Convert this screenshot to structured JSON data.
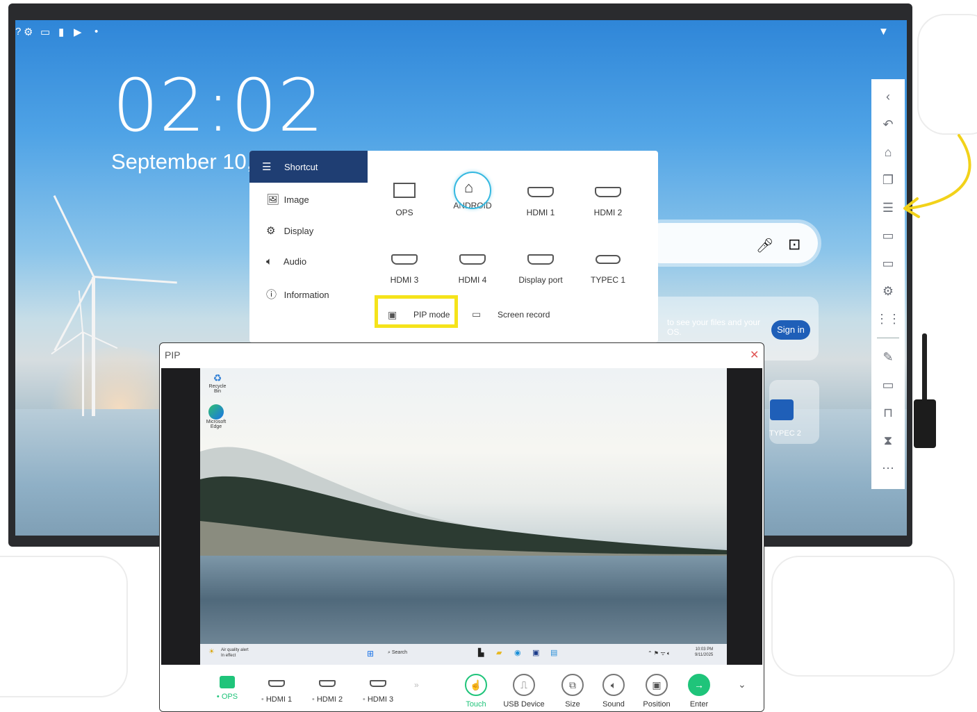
{
  "status_bar": {
    "icons": [
      "question-icon",
      "settings-gear-icon",
      "cast-icon",
      "usb-icon",
      "youtube-icon",
      "dot-icon"
    ],
    "wifi_icon": "wifi-icon"
  },
  "home": {
    "clock": "02:02",
    "date": "September 10,"
  },
  "shortcut_menu": {
    "tabs": [
      {
        "label": "Shortcut",
        "icon": "sliders-icon"
      },
      {
        "label": "Image",
        "icon": "image-icon"
      },
      {
        "label": "Display",
        "icon": "display-settings-icon"
      },
      {
        "label": "Audio",
        "icon": "speaker-icon"
      },
      {
        "label": "Information",
        "icon": "info-icon"
      }
    ],
    "sources": [
      "OPS",
      "ANDROID",
      "HDMI 1",
      "HDMI 2",
      "HDMI 3",
      "HDMI 4",
      "Display port",
      "TYPEC 1"
    ],
    "actions": {
      "pip": "PIP mode",
      "screen_record": "Screen record"
    }
  },
  "launcher": {
    "signin_hint": "to see your files and your OS.",
    "signin_button": "Sign in",
    "typec2_label": "TYPEC 2"
  },
  "sidebar": {
    "icons": [
      "collapse-chevron-icon",
      "back-icon",
      "home-icon",
      "windows-icon",
      "menu-icon",
      "cast-icon",
      "screen-icon",
      "settings-icon",
      "apps-icon",
      "pen-icon",
      "record-icon",
      "lock-icon",
      "timer-icon",
      "more-icon"
    ]
  },
  "pip": {
    "title": "PIP",
    "desktop": {
      "icons": [
        {
          "label": "Recycle Bin"
        },
        {
          "label": "Microsoft Edge"
        }
      ],
      "weather": "Air quality alert\nIn effect",
      "search": "Search",
      "time": "10:03 PM",
      "date": "9/11/2025"
    },
    "sources": [
      {
        "label": "OPS",
        "active": true
      },
      {
        "label": "HDMI 1",
        "active": false
      },
      {
        "label": "HDMI 2",
        "active": false
      },
      {
        "label": "HDMI 3",
        "active": false
      }
    ],
    "controls": [
      "Touch",
      "USB Device",
      "Size",
      "Sound",
      "Position",
      "Enter"
    ],
    "colors": {
      "accent": "#1fc47a",
      "highlight": "#f5e31a",
      "menu_active": "#1f3e73"
    }
  }
}
